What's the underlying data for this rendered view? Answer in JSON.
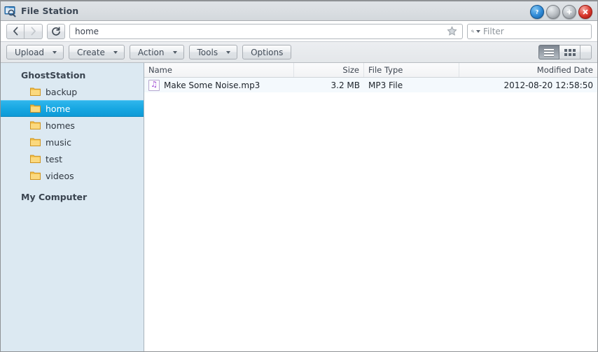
{
  "window": {
    "title": "File Station",
    "icon": "file-station-icon",
    "buttons": [
      {
        "name": "help-button",
        "glyph": "?",
        "color": "#2f89d6"
      },
      {
        "name": "minimize-button",
        "glyph": "",
        "color": "#b6bbc0"
      },
      {
        "name": "maximize-button",
        "glyph": "+",
        "color": "#b6bbc0"
      },
      {
        "name": "close-button",
        "glyph": "×",
        "color": "#d9372c"
      }
    ]
  },
  "navbar": {
    "back_label": "‹",
    "forward_label": "›",
    "refresh_label": "↻",
    "address_value": "home",
    "address_placeholder": "",
    "favorite_icon": "star-icon",
    "search_icon": "search-icon",
    "search_value": "",
    "search_placeholder": "Filter"
  },
  "toolbar": {
    "buttons": [
      {
        "label": "Upload",
        "has_menu": true,
        "name": "upload-button"
      },
      {
        "label": "Create",
        "has_menu": true,
        "name": "create-button"
      },
      {
        "label": "Action",
        "has_menu": true,
        "name": "action-button"
      },
      {
        "label": "Tools",
        "has_menu": true,
        "name": "tools-button"
      },
      {
        "label": "Options",
        "has_menu": false,
        "name": "options-button"
      }
    ],
    "view_modes": [
      {
        "name": "list-view-button",
        "icon": "list-view-icon",
        "active": true
      },
      {
        "name": "grid-view-button",
        "icon": "grid-view-icon",
        "active": false
      }
    ]
  },
  "sidebar": {
    "sections": [
      {
        "label": "GhostStation",
        "name": "tree-group-ghoststation",
        "items": [
          {
            "label": "backup",
            "selected": false,
            "icon": "folder-icon"
          },
          {
            "label": "home",
            "selected": true,
            "icon": "folder-icon"
          },
          {
            "label": "homes",
            "selected": false,
            "icon": "folder-icon"
          },
          {
            "label": "music",
            "selected": false,
            "icon": "folder-icon"
          },
          {
            "label": "test",
            "selected": false,
            "icon": "folder-icon"
          },
          {
            "label": "videos",
            "selected": false,
            "icon": "folder-icon"
          }
        ]
      },
      {
        "label": "My Computer",
        "name": "tree-group-my-computer",
        "items": []
      }
    ]
  },
  "filelist": {
    "columns": [
      {
        "label": "Name",
        "align": "left",
        "name": "column-header-name"
      },
      {
        "label": "Size",
        "align": "right",
        "name": "column-header-size"
      },
      {
        "label": "File Type",
        "align": "left",
        "name": "column-header-filetype"
      },
      {
        "label": "Modified Date",
        "align": "right",
        "name": "column-header-modified-date"
      }
    ],
    "rows": [
      {
        "name": "Make Some Noise.mp3",
        "size": "3.2 MB",
        "filetype": "MP3 File",
        "modified": "2012-08-20 12:58:50",
        "icon": "mp3-file-icon"
      }
    ]
  },
  "colors": {
    "selection_blue": "#17a7e2",
    "sidebar_bg": "#dce9f2",
    "titlebar_bg": "#dfe3e7",
    "row_bg": "#f4f9fd",
    "folder_yellow": "#f6c349",
    "mp3_purple": "#9b3fd1"
  }
}
